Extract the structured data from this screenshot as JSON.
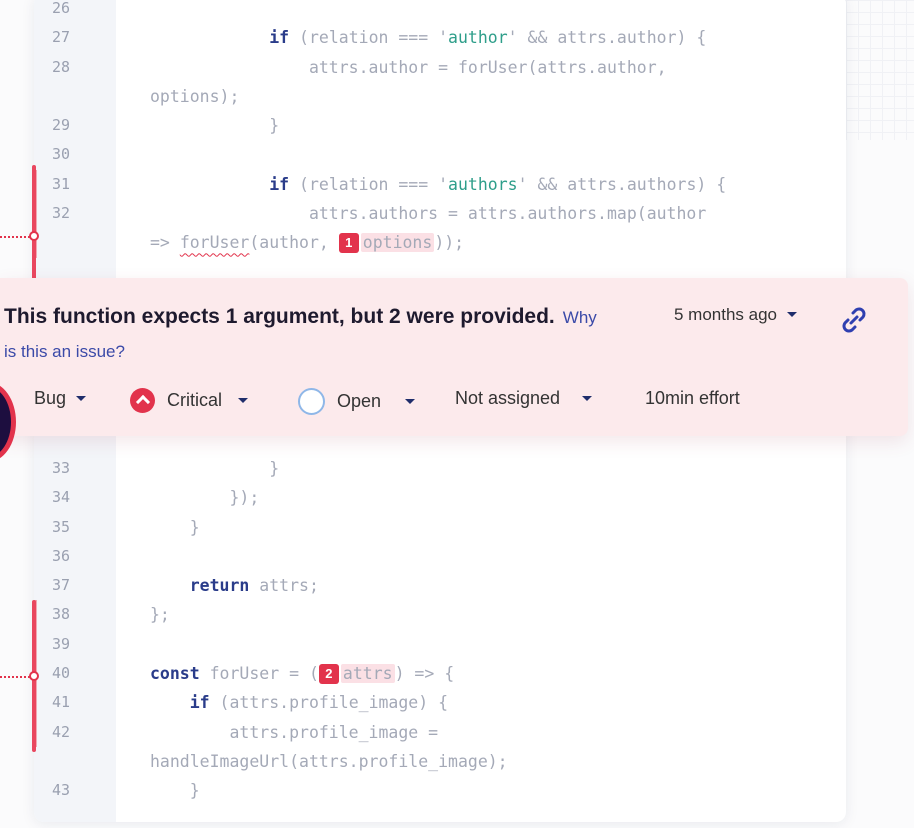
{
  "code_top": [
    {
      "n": "26",
      "html": ""
    },
    {
      "n": "27",
      "html": "            <span class='kw'>if</span> (relation === '<span class='str'>author</span>' &amp;&amp; attrs.author) {",
      "mark": false
    },
    {
      "n": "28",
      "html": "                attrs.author = forUser(attrs.author,"
    },
    {
      "n": "",
      "html": "options);"
    },
    {
      "n": "29",
      "html": "            }"
    },
    {
      "n": "30",
      "html": ""
    },
    {
      "n": "31",
      "html": "            <span class='kw'>if</span> (relation === '<span class='str'>authors</span>' &amp;&amp; attrs.authors) {",
      "mark": true
    },
    {
      "n": "32",
      "html": "                attrs.authors = attrs.authors.map(author",
      "mark": true
    },
    {
      "n": "",
      "html": "=&gt; <span class='squig'>forUser</span>(author, <span class='badge'>1</span><span class='hl'>options</span>));",
      "mark": true
    }
  ],
  "code_bottom": [
    {
      "n": "33",
      "html": "            }"
    },
    {
      "n": "34",
      "html": "        });"
    },
    {
      "n": "35",
      "html": "    }"
    },
    {
      "n": "36",
      "html": ""
    },
    {
      "n": "37",
      "html": "    <span class='kw'>return</span> attrs;"
    },
    {
      "n": "38",
      "html": "};",
      "mark": true
    },
    {
      "n": "39",
      "html": "",
      "mark": true
    },
    {
      "n": "40",
      "html": "<span class='kw'>const</span> forUser = (<span class='badge'>2</span><span class='hl'>attrs</span>) =&gt; {",
      "mark": true
    },
    {
      "n": "41",
      "html": "    <span class='kw'>if</span> (attrs.profile_image) {",
      "mark": true
    },
    {
      "n": "42",
      "html": "        attrs.profile_image =",
      "mark": true
    },
    {
      "n": "",
      "html": "handleImageUrl(attrs.profile_image);"
    },
    {
      "n": "43",
      "html": "    }"
    }
  ],
  "issue": {
    "message": "This function expects 1 argument, but 2 were provided.",
    "why_link": "Why is this an issue?",
    "age": "5 months ago",
    "type": "Bug",
    "severity": "Critical",
    "status": "Open",
    "assignee": "Not assigned",
    "effort": "10min effort"
  },
  "colors": {
    "accent": "#e2334c",
    "link": "#3b4aa8",
    "issue_bg": "#fceaec"
  },
  "icons": {
    "severity": "critical-chevron-up-icon",
    "status": "open-circle-icon",
    "permalink": "link-icon"
  }
}
